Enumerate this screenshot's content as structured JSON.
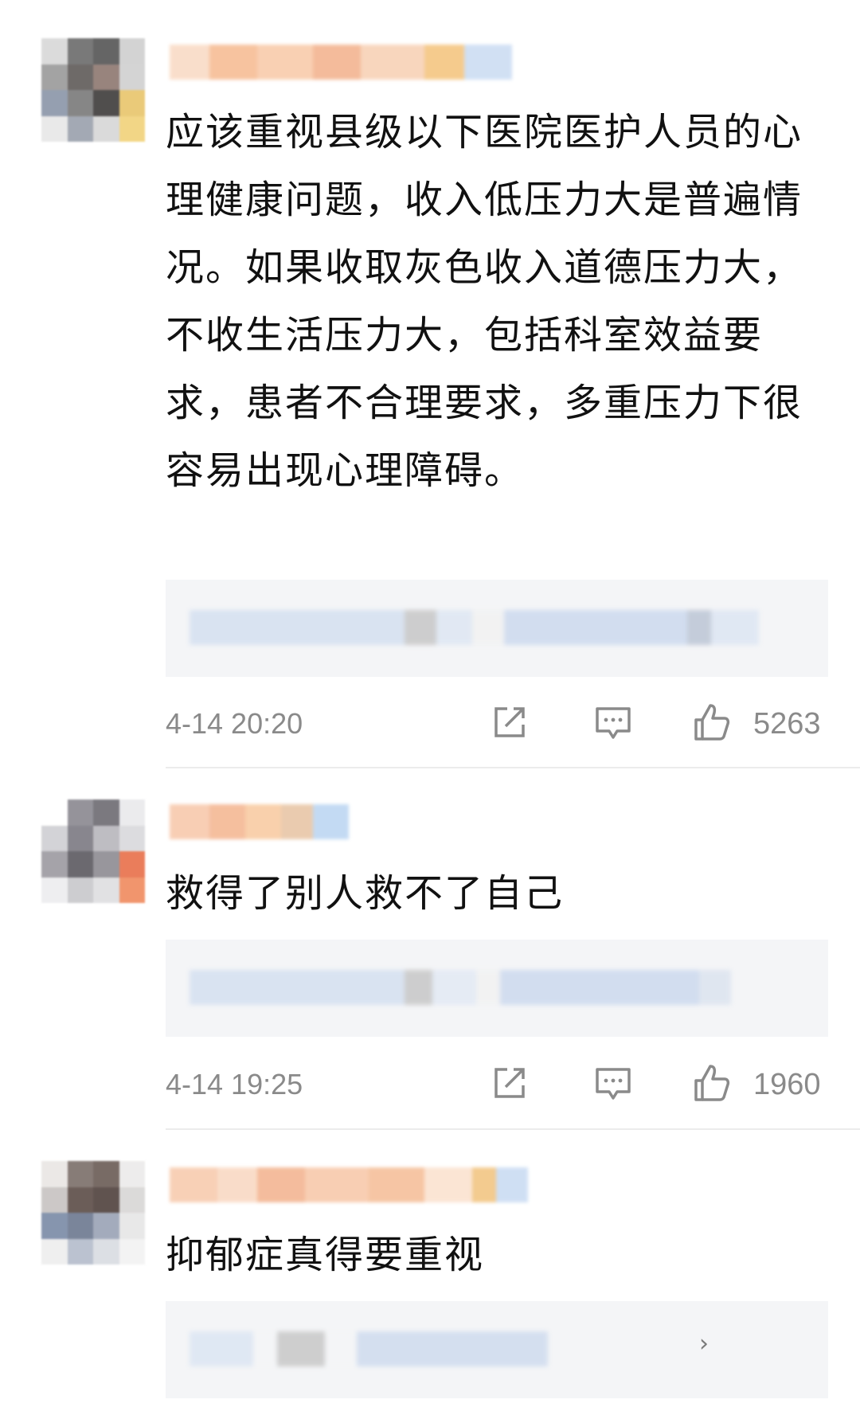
{
  "comments": [
    {
      "text": "应该重视县级以下医院医护人员的心理健康问题，收入低压力大是普遍情况。如果收取灰色收入道德压力大，不收生活压力大，包括科室效益要求，患者不合理要求，多重压力下很容易出现心理障碍。",
      "timestamp": "4-14 20:20",
      "likes": "5263"
    },
    {
      "text": "救得了别人救不了自己",
      "timestamp": "4-14 19:25",
      "likes": "1960"
    },
    {
      "text": "抑郁症真得要重视",
      "reply_arrow": "›"
    }
  ],
  "icons": {
    "share": "share-icon",
    "comment": "comment-icon",
    "like": "thumbs-up-icon"
  },
  "colors": {
    "text": "#111111",
    "meta": "#8a8a8a",
    "reply_bg": "#f4f5f7",
    "username_blur": "#f6c7a5",
    "reply_blur": "#cfdcf0"
  }
}
